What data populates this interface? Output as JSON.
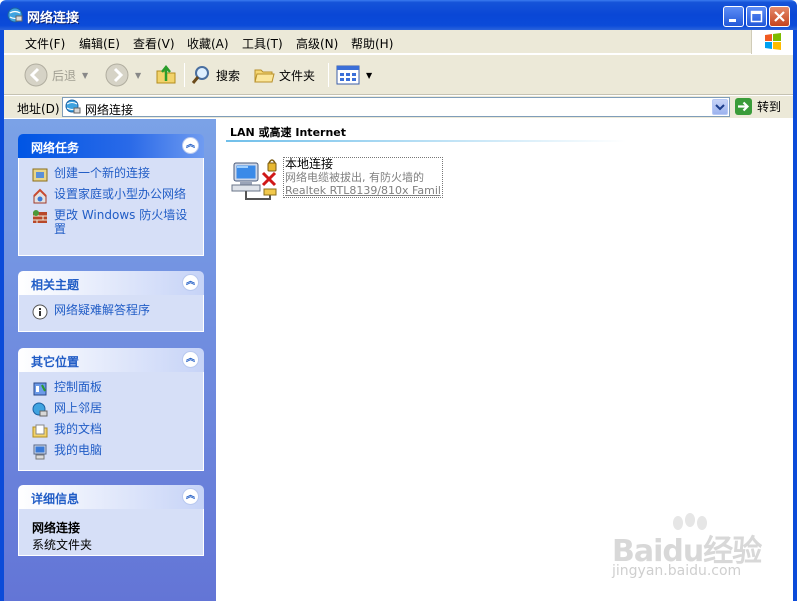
{
  "window": {
    "title": "网络连接"
  },
  "menu": {
    "items": [
      "文件(F)",
      "编辑(E)",
      "查看(V)",
      "收藏(A)",
      "工具(T)",
      "高级(N)",
      "帮助(H)"
    ]
  },
  "toolbar": {
    "back_label": "后退",
    "search_label": "搜索",
    "folders_label": "文件夹"
  },
  "address": {
    "label": "地址(D)",
    "value": "网络连接",
    "go_label": "转到"
  },
  "taskpane": {
    "network_tasks": {
      "title": "网络任务",
      "items": [
        {
          "label": "创建一个新的连接",
          "icon": "new-connection-icon"
        },
        {
          "label": "设置家庭或小型办公网络",
          "icon": "home-network-icon"
        },
        {
          "label": "更改 Windows 防火墙设置",
          "icon": "firewall-icon"
        }
      ]
    },
    "related": {
      "title": "相关主题",
      "items": [
        {
          "label": "网络疑难解答程序",
          "icon": "info-icon"
        }
      ]
    },
    "other_places": {
      "title": "其它位置",
      "items": [
        {
          "label": "控制面板",
          "icon": "control-panel-icon"
        },
        {
          "label": "网上邻居",
          "icon": "network-places-icon"
        },
        {
          "label": "我的文档",
          "icon": "my-documents-icon"
        },
        {
          "label": "我的电脑",
          "icon": "my-computer-icon"
        }
      ]
    },
    "details": {
      "title": "详细信息",
      "name": "网络连接",
      "type": "系统文件夹"
    }
  },
  "content": {
    "group_header": "LAN 或高速 Internet",
    "connection": {
      "name": "本地连接",
      "status": "网络电缆被拔出, 有防火墙的",
      "device": "Realtek RTL8139/810x Family ..."
    }
  },
  "watermark": {
    "main": "Baidu经验",
    "sub": "jingyan.baidu.com"
  },
  "colors": {
    "titlebar": "#0b4bd9",
    "taskpane_link": "#215dc6",
    "panel_body": "#d6dff7"
  }
}
